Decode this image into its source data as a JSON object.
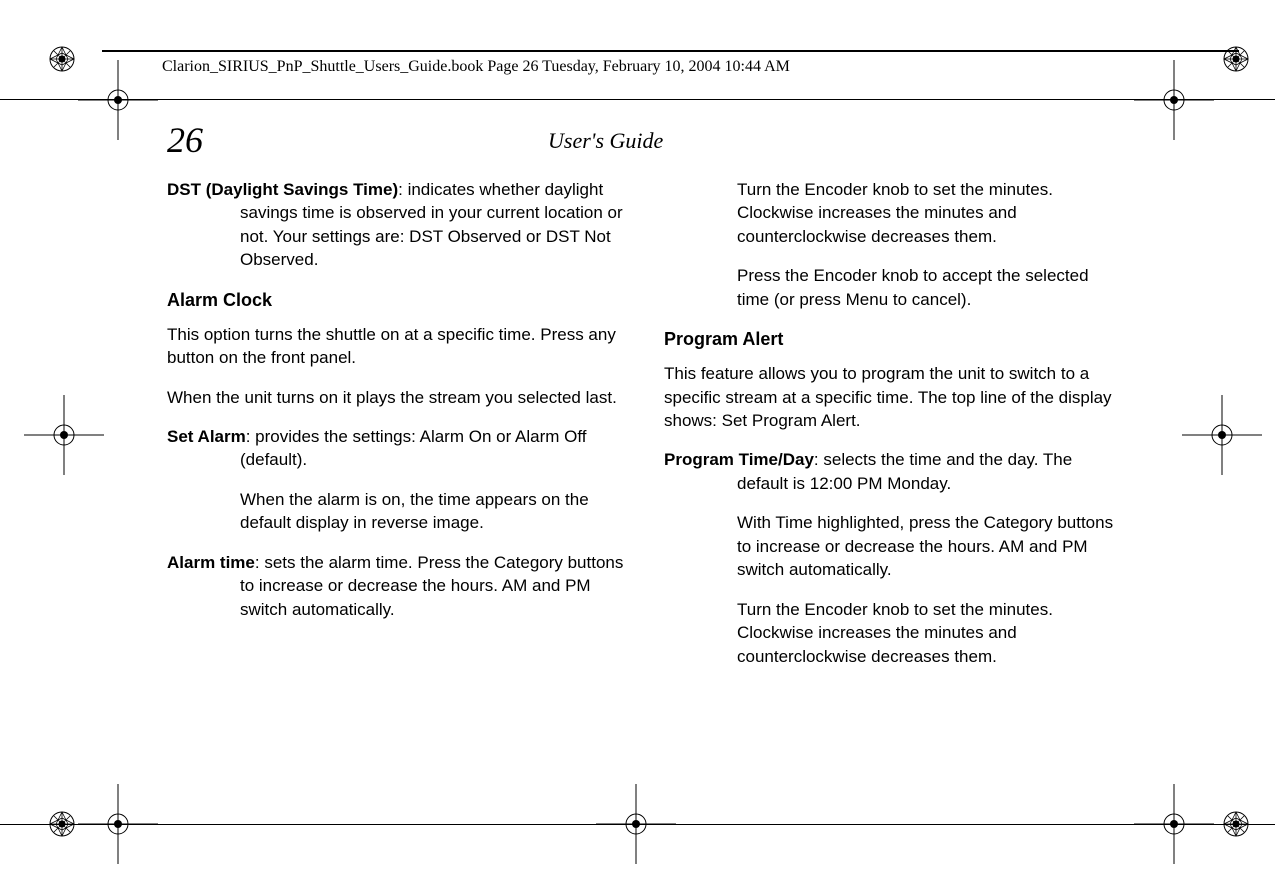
{
  "header": {
    "line": "Clarion_SIRIUS_PnP_Shuttle_Users_Guide.book  Page 26  Tuesday, February 10, 2004  10:44 AM"
  },
  "page": {
    "number": "26",
    "running_head": "User's Guide"
  },
  "left_col": {
    "dst_bold": "DST (Daylight Savings Time)",
    "dst_rest": ": indicates whether daylight savings time is observed in your current location or not. Your settings are: DST Observed or DST Not Observed.",
    "alarm_clock_heading": "Alarm Clock",
    "alarm_clock_p1": "This option turns the shuttle on at a specific time. Press any button on the front panel.",
    "alarm_clock_p2": "When the unit turns on it plays the stream you selected last.",
    "set_alarm_bold": "Set Alarm",
    "set_alarm_rest": ": provides the settings: Alarm On or Alarm Off (default).",
    "set_alarm_sub": "When the alarm is on, the time appears on the default display in reverse image.",
    "alarm_time_bold": "Alarm time",
    "alarm_time_rest": ": sets the alarm time. Press the Category buttons to increase or decrease the hours. AM and PM switch automatically."
  },
  "right_col": {
    "cont_p1": "Turn the Encoder knob to set the minutes. Clockwise increases the minutes and counterclockwise decreases them.",
    "cont_p2": "Press the Encoder knob to accept the selected time (or press Menu to cancel).",
    "program_alert_heading": "Program Alert",
    "program_alert_p1": "This feature allows you to program the unit to switch to a specific stream at a specific time. The top line of the display shows: Set Program Alert.",
    "ptd_bold": "Program Time/Day",
    "ptd_rest": ": selects the time and the day. The default is 12:00 PM Monday.",
    "ptd_sub1": "With Time highlighted, press the Category buttons to increase or decrease the hours. AM and PM switch automatically.",
    "ptd_sub2": "Turn the Encoder knob to set the minutes. Clockwise increases the minutes and counterclockwise decreases them."
  }
}
